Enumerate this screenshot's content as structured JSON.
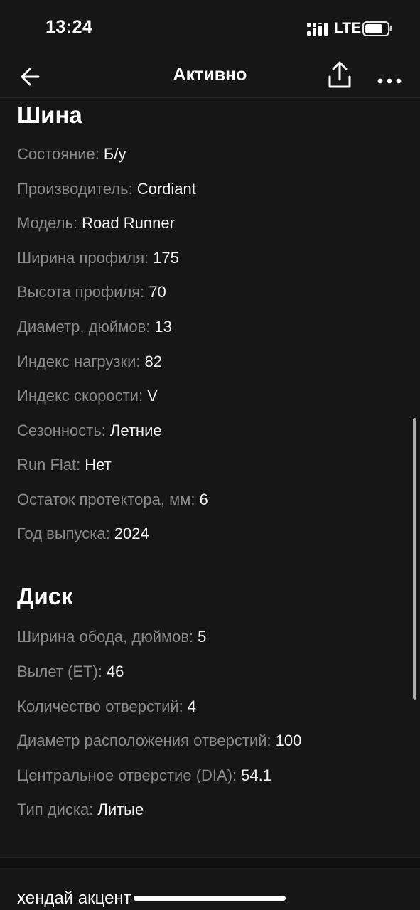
{
  "status_bar": {
    "time": "13:24",
    "network": "LTE",
    "icons": [
      "signal-bars-icon",
      "battery-icon"
    ]
  },
  "nav": {
    "title": "Активно",
    "icons": [
      "arrow-left-icon",
      "share-icon",
      "more-horizontal-icon"
    ]
  },
  "tire_section": {
    "title": "Шина",
    "rows": [
      {
        "label": "Состояние:",
        "value": "Б/у"
      },
      {
        "label": "Производитель:",
        "value": "Cordiant"
      },
      {
        "label": "Модель:",
        "value": "Road Runner"
      },
      {
        "label": "Ширина профиля:",
        "value": "175"
      },
      {
        "label": "Высота профиля:",
        "value": "70"
      },
      {
        "label": "Диаметр, дюймов:",
        "value": "13"
      },
      {
        "label": "Индекс нагрузки:",
        "value": "82"
      },
      {
        "label": "Индекс скорости:",
        "value": "V"
      },
      {
        "label": "Сезонность:",
        "value": "Летние"
      },
      {
        "label": "Run Flat:",
        "value": "Нет"
      },
      {
        "label": "Остаток протектора, мм:",
        "value": "6"
      },
      {
        "label": "Год выпуска:",
        "value": "2024"
      }
    ]
  },
  "disk_section": {
    "title": "Диск",
    "rows": [
      {
        "label": "Ширина обода, дюймов:",
        "value": "5"
      },
      {
        "label": "Вылет (ET):",
        "value": "46"
      },
      {
        "label": "Количество отверстий:",
        "value": "4"
      },
      {
        "label": "Диаметр расположения отверстий:",
        "value": "100"
      },
      {
        "label": "Центральное отверстие (DIA):",
        "value": "54.1"
      },
      {
        "label": "Тип диска:",
        "value": "Литые"
      }
    ]
  },
  "next_card": {
    "title": "хендай акцент"
  },
  "colors": {
    "background": "#161616",
    "label": "#8a8a8a",
    "value": "#f2f2f2"
  }
}
